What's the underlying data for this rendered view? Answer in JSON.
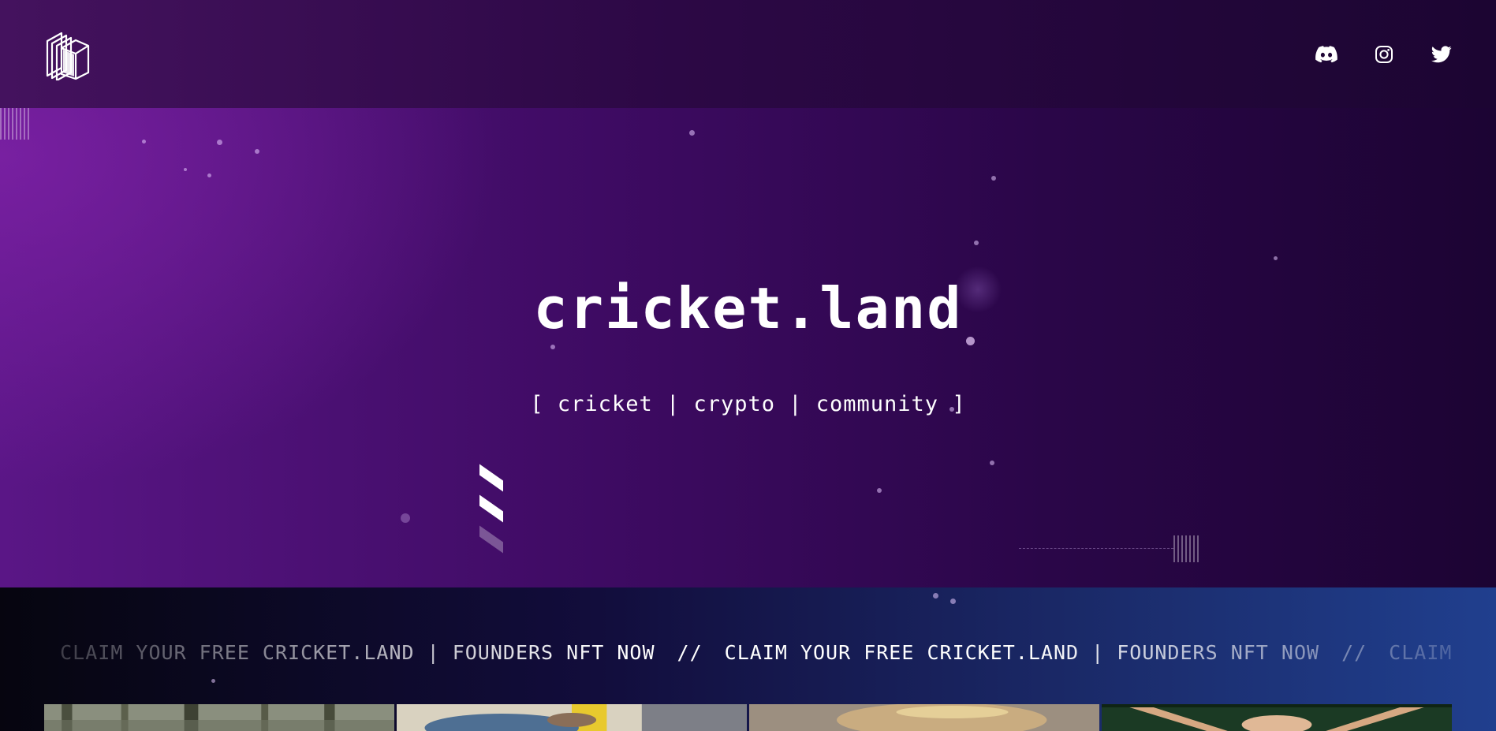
{
  "header": {
    "logo_icon": "stacked-cards-logo-icon",
    "social": [
      {
        "name": "discord",
        "icon": "discord-icon"
      },
      {
        "name": "instagram",
        "icon": "instagram-icon"
      },
      {
        "name": "twitter",
        "icon": "twitter-icon"
      }
    ]
  },
  "hero": {
    "title": "cricket.land",
    "tagline": "[ cricket | crypto | community ]"
  },
  "marquee": {
    "separator": "//",
    "text": "CLAIM YOUR FREE CRICKET.LAND | FOUNDERS NFT NOW"
  },
  "gallery": {
    "thumbnails": [
      {
        "icon": "forest-photo-thumbnail"
      },
      {
        "icon": "cricketer-photo-thumbnail"
      },
      {
        "icon": "portrait-photo-thumbnail"
      },
      {
        "icon": "celebration-photo-thumbnail"
      }
    ]
  },
  "colors": {
    "header_bg": "#2c0845",
    "hero_accent": "#5a1686",
    "marquee_bg": "#203f8e",
    "text": "#ffffff"
  }
}
